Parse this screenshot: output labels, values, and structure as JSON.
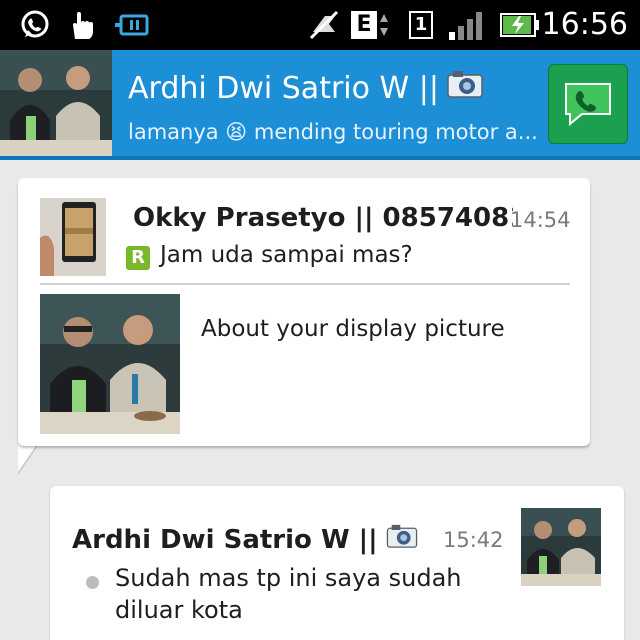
{
  "status_bar": {
    "time": "16:56",
    "network_type": "E",
    "sim_slot": "1",
    "icons": [
      "whatsapp-icon",
      "touch-icon",
      "usb-icon",
      "mute-icon",
      "network-e-icon",
      "sim-icon",
      "signal-icon",
      "battery-charging-icon"
    ]
  },
  "header": {
    "contact_name": "Ardhi Dwi Satrio W ||",
    "status_text": "lamanya 😫 mending touring motor a...",
    "call_icon": "phone-icon",
    "accent": "#1d8fd6",
    "call_color": "#1aa04f"
  },
  "quoted_message": {
    "sender": "Okky Prasetyo || 08574081...",
    "time": "14:54",
    "badge": "R",
    "text": "Jam uda sampai mas?",
    "attachment_label": "About your display picture"
  },
  "sent_message": {
    "sender": "Ardhi Dwi Satrio W ||",
    "time": "15:42",
    "text": "Sudah mas tp ini saya sudah diluar kota"
  }
}
